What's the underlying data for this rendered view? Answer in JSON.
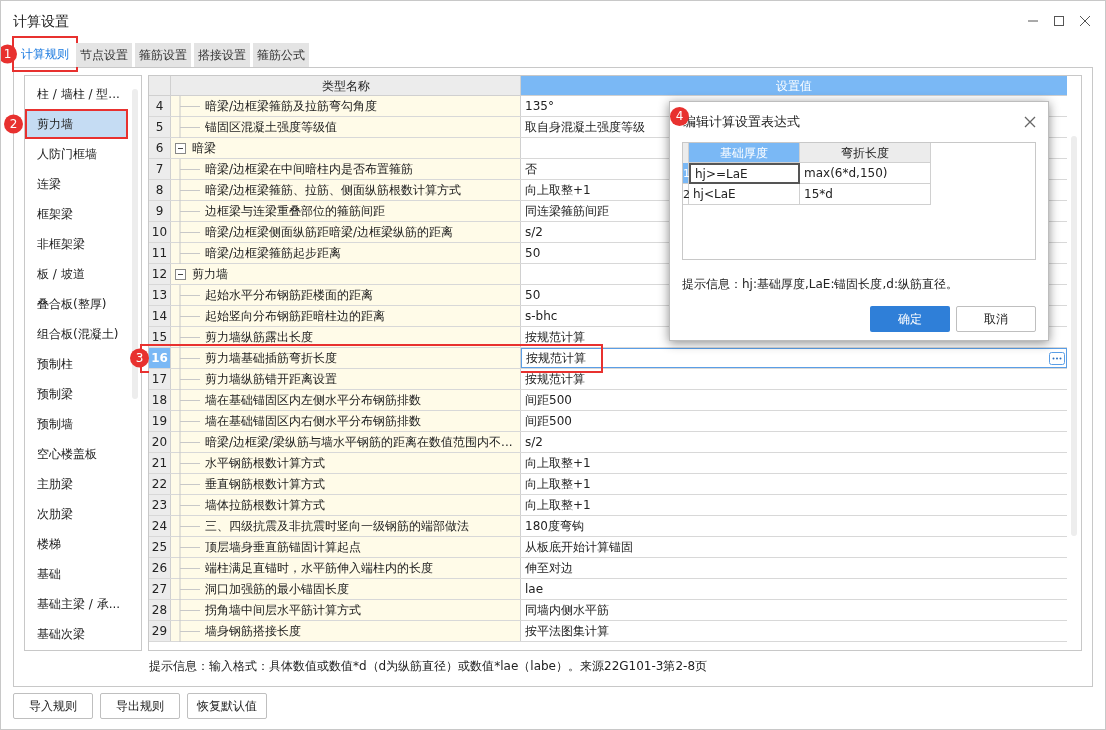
{
  "window": {
    "title": "计算设置"
  },
  "tabs": [
    {
      "label": "计算规则",
      "selected": true,
      "marker": "1"
    },
    {
      "label": "节点设置",
      "selected": false
    },
    {
      "label": "箍筋设置",
      "selected": false
    },
    {
      "label": "搭接设置",
      "selected": false
    },
    {
      "label": "箍筋公式",
      "selected": false
    }
  ],
  "sidebar": {
    "items": [
      {
        "label": "柱 / 墙柱 / 型...",
        "selected": false
      },
      {
        "label": "剪力墙",
        "selected": true,
        "marker": "2"
      },
      {
        "label": "人防门框墙",
        "selected": false
      },
      {
        "label": "连梁",
        "selected": false
      },
      {
        "label": "框架梁",
        "selected": false
      },
      {
        "label": "非框架梁",
        "selected": false
      },
      {
        "label": "板 / 坡道",
        "selected": false
      },
      {
        "label": "叠合板(整厚)",
        "selected": false
      },
      {
        "label": "组合板(混凝土)",
        "selected": false
      },
      {
        "label": "预制柱",
        "selected": false
      },
      {
        "label": "预制梁",
        "selected": false
      },
      {
        "label": "预制墙",
        "selected": false
      },
      {
        "label": "空心楼盖板",
        "selected": false
      },
      {
        "label": "主肋梁",
        "selected": false
      },
      {
        "label": "次肋梁",
        "selected": false
      },
      {
        "label": "楼梯",
        "selected": false
      },
      {
        "label": "基础",
        "selected": false
      },
      {
        "label": "基础主梁 / 承...",
        "selected": false
      },
      {
        "label": "基础次梁",
        "selected": false
      }
    ]
  },
  "table": {
    "columns": [
      "类型名称",
      "设置值"
    ],
    "rows": [
      {
        "num": "4",
        "kind": "item",
        "name": "暗梁/边框梁箍筋及拉筋弯勾角度",
        "value": "135°",
        "selected": false
      },
      {
        "num": "5",
        "kind": "item",
        "name": "锚固区混凝土强度等级值",
        "value": "取自身混凝土强度等级",
        "selected": false
      },
      {
        "num": "6",
        "kind": "group",
        "name": "暗梁",
        "value": "",
        "selected": false
      },
      {
        "num": "7",
        "kind": "item",
        "name": "暗梁/边框梁在中间暗柱内是否布置箍筋",
        "value": "否",
        "selected": false
      },
      {
        "num": "8",
        "kind": "item",
        "name": "暗梁/边框梁箍筋、拉筋、侧面纵筋根数计算方式",
        "value": "向上取整+1",
        "selected": false
      },
      {
        "num": "9",
        "kind": "item",
        "name": "边框梁与连梁重叠部位的箍筋间距",
        "value": "同连梁箍筋间距",
        "selected": false
      },
      {
        "num": "10",
        "kind": "item",
        "name": "暗梁/边框梁侧面纵筋距暗梁/边框梁纵筋的距离",
        "value": "s/2",
        "selected": false
      },
      {
        "num": "11",
        "kind": "item",
        "name": "暗梁/边框梁箍筋起步距离",
        "value": "50",
        "selected": false
      },
      {
        "num": "12",
        "kind": "group",
        "name": "剪力墙",
        "value": "",
        "selected": false
      },
      {
        "num": "13",
        "kind": "item",
        "name": "起始水平分布钢筋距楼面的距离",
        "value": "50",
        "selected": false
      },
      {
        "num": "14",
        "kind": "item",
        "name": "起始竖向分布钢筋距暗柱边的距离",
        "value": "s-bhc",
        "selected": false
      },
      {
        "num": "15",
        "kind": "item",
        "name": "剪力墙纵筋露出长度",
        "value": "按规范计算",
        "selected": false
      },
      {
        "num": "16",
        "kind": "item",
        "name": "剪力墙基础插筋弯折长度",
        "value": "按规范计算",
        "selected": true,
        "marker": "3"
      },
      {
        "num": "17",
        "kind": "item",
        "name": "剪力墙纵筋错开距离设置",
        "value": "按规范计算",
        "selected": false
      },
      {
        "num": "18",
        "kind": "item",
        "name": "墙在基础锚固区内左侧水平分布钢筋排数",
        "value": "间距500",
        "selected": false
      },
      {
        "num": "19",
        "kind": "item",
        "name": "墙在基础锚固区内右侧水平分布钢筋排数",
        "value": "间距500",
        "selected": false
      },
      {
        "num": "20",
        "kind": "item",
        "name": "暗梁/边框梁/梁纵筋与墙水平钢筋的距离在数值范围内不...",
        "value": "s/2",
        "selected": false
      },
      {
        "num": "21",
        "kind": "item",
        "name": "水平钢筋根数计算方式",
        "value": "向上取整+1",
        "selected": false
      },
      {
        "num": "22",
        "kind": "item",
        "name": "垂直钢筋根数计算方式",
        "value": "向上取整+1",
        "selected": false
      },
      {
        "num": "23",
        "kind": "item",
        "name": "墙体拉筋根数计算方式",
        "value": "向上取整+1",
        "selected": false
      },
      {
        "num": "24",
        "kind": "item",
        "name": "三、四级抗震及非抗震时竖向一级钢筋的端部做法",
        "value": "180度弯钩",
        "selected": false
      },
      {
        "num": "25",
        "kind": "item",
        "name": "顶层墙身垂直筋锚固计算起点",
        "value": "从板底开始计算锚固",
        "selected": false
      },
      {
        "num": "26",
        "kind": "item",
        "name": "端柱满足直锚时，水平筋伸入端柱内的长度",
        "value": "伸至对边",
        "selected": false
      },
      {
        "num": "27",
        "kind": "item",
        "name": "洞口加强筋的最小锚固长度",
        "value": "lae",
        "selected": false
      },
      {
        "num": "28",
        "kind": "item",
        "name": "拐角墙中间层水平筋计算方式",
        "value": "同墙内侧水平筋",
        "selected": false
      },
      {
        "num": "29",
        "kind": "item",
        "name": "墙身钢筋搭接长度",
        "value": "按平法图集计算",
        "selected": false
      }
    ]
  },
  "hint": "提示信息：输入格式：具体数值或数值*d（d为纵筋直径）或数值*lae（labe）。来源22G101-3第2-8页",
  "buttons": [
    "导入规则",
    "导出规则",
    "恢复默认值"
  ],
  "dialog": {
    "title": "编辑计算设置表达式",
    "marker": "4",
    "columns": [
      {
        "label": "基础厚度",
        "selected": true
      },
      {
        "label": "弯折长度",
        "selected": false
      }
    ],
    "rows": [
      {
        "num": "1",
        "cells": [
          "hj>=LaE",
          "max(6*d,150)"
        ],
        "selected": true
      },
      {
        "num": "2",
        "cells": [
          "hj<LaE",
          "15*d"
        ],
        "selected": false
      }
    ],
    "hint": "提示信息：hj:基础厚度,LaE:锚固长度,d:纵筋直径。",
    "ok": "确定",
    "cancel": "取消"
  }
}
